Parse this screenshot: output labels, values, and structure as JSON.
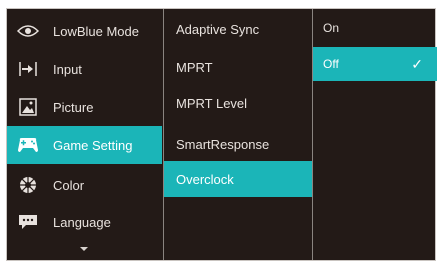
{
  "main_menu": [
    {
      "label": "LowBlue Mode",
      "icon": "eye-icon"
    },
    {
      "label": "Input",
      "icon": "input-arrow-icon"
    },
    {
      "label": "Picture",
      "icon": "picture-icon"
    },
    {
      "label": "Game Setting",
      "icon": "gamepad-icon",
      "selected": true
    },
    {
      "label": "Color",
      "icon": "color-wheel-icon"
    },
    {
      "label": "Language",
      "icon": "speech-bubble-icon"
    }
  ],
  "submenu": [
    {
      "label": "Adaptive Sync"
    },
    {
      "label": "MPRT"
    },
    {
      "label": "MPRT Level"
    },
    {
      "label": "SmartResponse"
    },
    {
      "label": "Overclock",
      "selected": true
    }
  ],
  "options": [
    {
      "label": "On"
    },
    {
      "label": "Off",
      "selected": true,
      "check": "✓"
    }
  ],
  "colors": {
    "accent": "#1bb5b8",
    "background": "#231a17",
    "text": "#e8e2de"
  }
}
